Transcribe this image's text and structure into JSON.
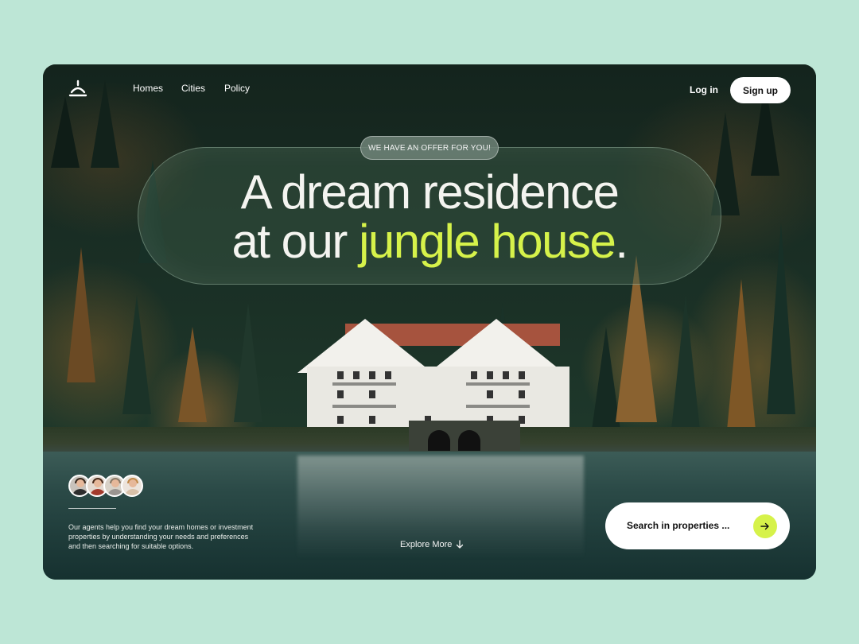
{
  "nav": {
    "items": [
      "Homes",
      "Cities",
      "Policy"
    ],
    "login": "Log in",
    "signup": "Sign up"
  },
  "hero": {
    "badge": "WE HAVE AN OFFER FOR YOU!",
    "line1": "A dream residence",
    "line2_prefix": "at our ",
    "line2_accent": "jungle house",
    "line2_suffix": "."
  },
  "agents": {
    "description": "Our agents help you find your dream homes or investment properties by understanding your needs and preferences and then searching for suitable options."
  },
  "explore": {
    "label": "Explore More",
    "icon": "arrow-down-icon"
  },
  "search": {
    "placeholder": "Search in properties ...",
    "icon": "arrow-right-icon"
  },
  "colors": {
    "page_bg": "#bde6d6",
    "accent": "#d6f24a",
    "text": "#f4f4f0"
  }
}
